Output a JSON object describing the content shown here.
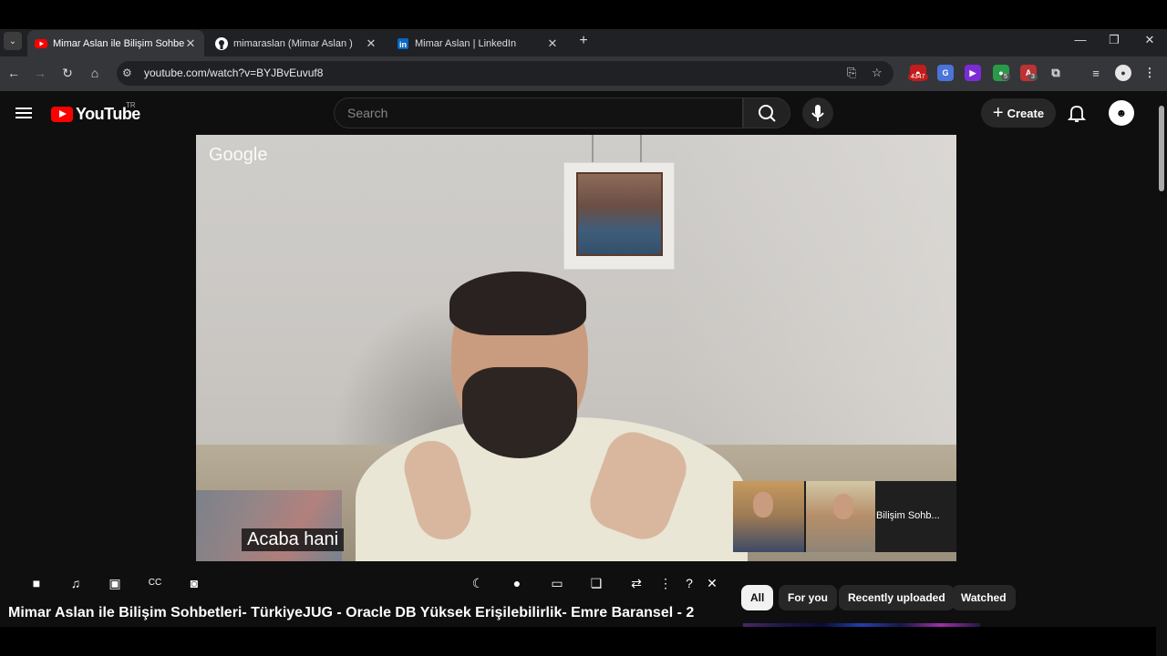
{
  "browser": {
    "tabs": [
      {
        "title": "Mimar Aslan ile Bilişim Sohbetle",
        "favicon": "youtube-icon",
        "active": true
      },
      {
        "title": "mimaraslan (Mimar Aslan )",
        "favicon": "github-icon",
        "active": false
      },
      {
        "title": "Mimar Aslan | LinkedIn",
        "favicon": "linkedin-icon",
        "active": false
      }
    ],
    "url": "youtube.com/watch?v=BYJBvEuvuf8",
    "extensions": {
      "badge_red": "4347",
      "badge_green": "5",
      "badge_gray": "3"
    }
  },
  "youtube": {
    "logo_text": "YouTube",
    "country_code": "TR",
    "search_placeholder": "Search",
    "create_label": "Create",
    "brand_color": "#ff0000"
  },
  "video": {
    "watermark": "Google",
    "subtitle": "Acaba hani",
    "participant_label": "Bilişim Sohb...",
    "title": "Mimar Aslan ile Bilişim Sohbetleri- TürkiyeJUG - Oracle DB Yüksek Erişilebilirlik- Emre Baransel - 2"
  },
  "chips": [
    "All",
    "For you",
    "Recently uploaded",
    "Watched"
  ]
}
